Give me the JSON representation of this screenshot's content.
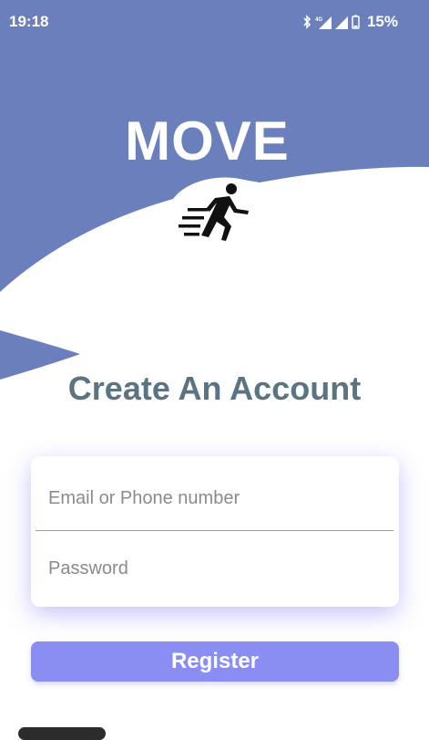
{
  "status_bar": {
    "time": "19:18",
    "battery": "15%",
    "icons": [
      "bluetooth-icon",
      "signal-4g-icon",
      "signal-icon",
      "battery-icon"
    ]
  },
  "header": {
    "app_title": "MOVE",
    "logo_icon": "running-person-icon"
  },
  "form": {
    "heading": "Create An Account",
    "email_placeholder": "Email or Phone number",
    "password_placeholder": "Password",
    "register_label": "Register"
  },
  "colors": {
    "header_background": "#6b7fbd",
    "heading_text": "#5b7482",
    "button_background": "#8a8ef2",
    "card_shadow": "#7d7df5"
  }
}
